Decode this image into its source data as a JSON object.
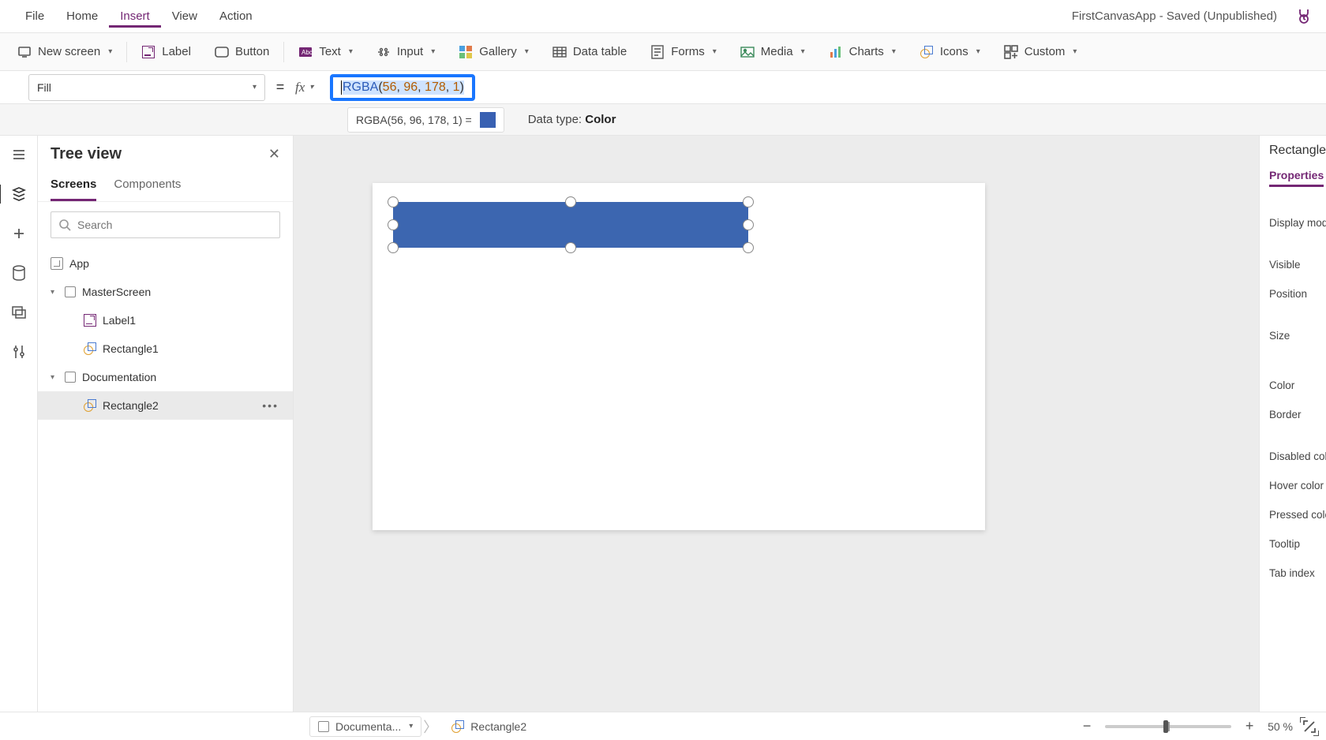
{
  "app": {
    "title": "FirstCanvasApp - Saved (Unpublished)"
  },
  "menu": {
    "file": "File",
    "home": "Home",
    "insert": "Insert",
    "view": "View",
    "action": "Action"
  },
  "ribbon": {
    "new_screen": "New screen",
    "label": "Label",
    "button": "Button",
    "text": "Text",
    "input": "Input",
    "gallery": "Gallery",
    "data_table": "Data table",
    "forms": "Forms",
    "media": "Media",
    "charts": "Charts",
    "icons": "Icons",
    "custom": "Custom"
  },
  "formula": {
    "property": "Fill",
    "fn": "RGBA",
    "a1": "56",
    "a2": "96",
    "a3": "178",
    "a4": "1",
    "result_text": "RGBA(56, 96, 178, 1)  =",
    "datatype_label": "Data type: ",
    "datatype_value": "Color",
    "swatch": "#3860b2"
  },
  "tree": {
    "title": "Tree view",
    "tabs": {
      "screens": "Screens",
      "components": "Components"
    },
    "search_placeholder": "Search",
    "app_node": "App",
    "items": [
      {
        "label": "MasterScreen"
      },
      {
        "label": "Label1"
      },
      {
        "label": "Rectangle1"
      },
      {
        "label": "Documentation"
      },
      {
        "label": "Rectangle2"
      }
    ]
  },
  "properties": {
    "title": "Rectangle",
    "tab": "Properties",
    "rows": [
      "Display mode",
      "Visible",
      "Position",
      "Size",
      "Color",
      "Border",
      "Disabled color",
      "Hover color",
      "Pressed color",
      "Tooltip",
      "Tab index"
    ]
  },
  "status": {
    "screen": "Documenta...",
    "control": "Rectangle2",
    "zoom": "50  %"
  }
}
